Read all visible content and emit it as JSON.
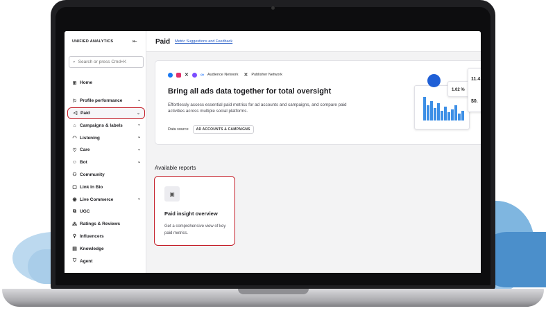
{
  "sidebar": {
    "title": "UNIFIED ANALYTICS",
    "search_placeholder": "Search or press Cmd+K",
    "items": [
      {
        "label": "Home",
        "icon": "grid-icon",
        "chevron": false
      },
      {
        "label": "Profile performance",
        "icon": "flag-icon",
        "chevron": true
      },
      {
        "label": "Paid",
        "icon": "megaphone-icon",
        "chevron": true,
        "selected": true
      },
      {
        "label": "Campaigns & labels",
        "icon": "tag-icon",
        "chevron": true
      },
      {
        "label": "Listening",
        "icon": "headphones-icon",
        "chevron": true
      },
      {
        "label": "Care",
        "icon": "heart-hand-icon",
        "chevron": true
      },
      {
        "label": "Bot",
        "icon": "bot-icon",
        "chevron": true
      },
      {
        "label": "Community",
        "icon": "community-icon",
        "chevron": false
      },
      {
        "label": "Link In Bio",
        "icon": "link-bio-icon",
        "chevron": false
      },
      {
        "label": "Live Commerce",
        "icon": "live-icon",
        "chevron": true
      },
      {
        "label": "UGC",
        "icon": "ugc-icon",
        "chevron": false
      },
      {
        "label": "Ratings & Reviews",
        "icon": "ratings-icon",
        "chevron": false
      },
      {
        "label": "Influencers",
        "icon": "influencers-icon",
        "chevron": false
      },
      {
        "label": "Knowledge",
        "icon": "book-icon",
        "chevron": false
      },
      {
        "label": "Agent",
        "icon": "agent-icon",
        "chevron": false
      }
    ]
  },
  "header": {
    "title": "Paid",
    "link": "Metric Suggestions and Feedback"
  },
  "banner": {
    "platforms": [
      "Audience Network",
      "Publisher Network"
    ],
    "title": "Bring all ads data together for total oversight",
    "description": "Effortlessly access essential paid metrics for ad accounts and campaigns, and compare paid activities across multiple social platforms.",
    "data_source_label": "Data source",
    "data_source_value": "AD ACCOUNTS & CAMPAIGNS",
    "illustration_metrics": [
      "1.02 %",
      "11.4",
      "$0."
    ],
    "colors": {
      "facebook": "#1877f2",
      "instagram": "#e1306c",
      "x": "#111111",
      "messenger": "#7b4dff",
      "meta": "#0866ff"
    }
  },
  "available_reports": {
    "heading": "Available reports",
    "cards": [
      {
        "title": "Paid insight overview",
        "description": "Get a comprehensive view of key paid metrics."
      }
    ]
  },
  "accent_color": "#c4202a"
}
